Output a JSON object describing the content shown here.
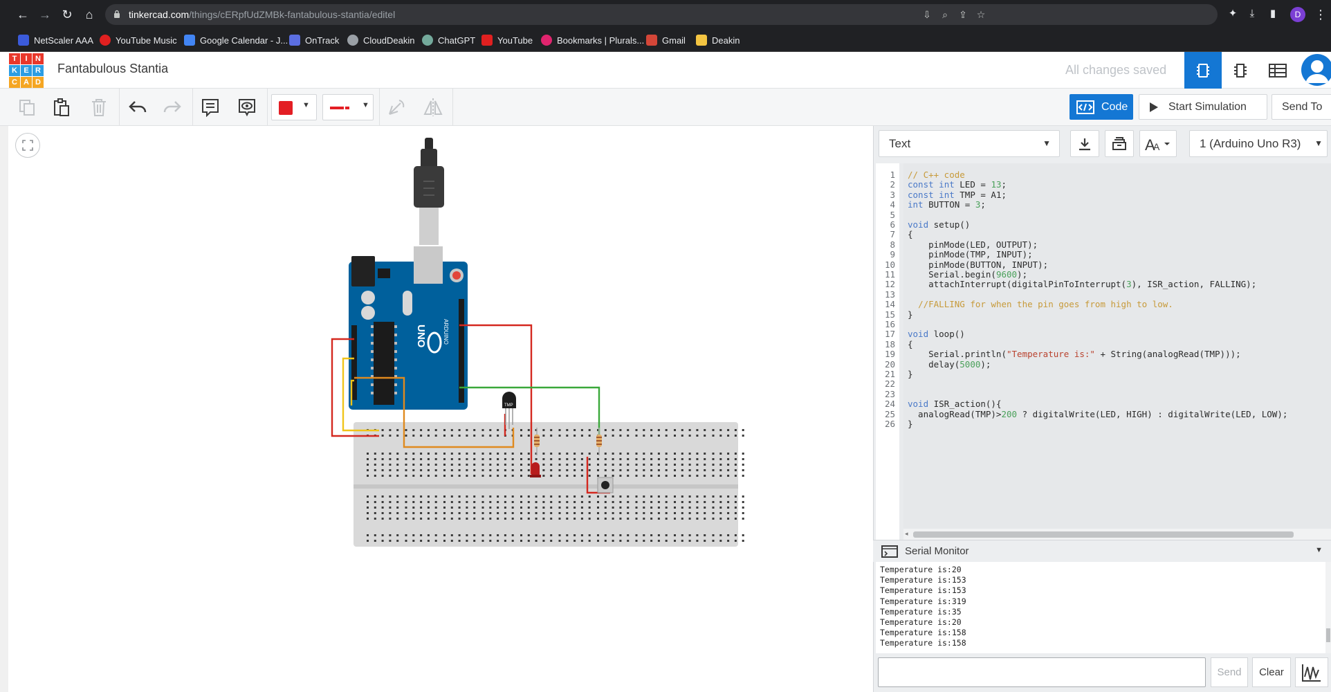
{
  "browser": {
    "url_host": "tinkercad.com",
    "url_path": "/things/cERpfUdZMBk-fantabulous-stantia/editel",
    "profile_initial": "D",
    "bookmarks": [
      {
        "label": "NetScaler AAA",
        "color": "#3b5bdb"
      },
      {
        "label": "YouTube Music",
        "color": "#e02020"
      },
      {
        "label": "Google Calendar - J...",
        "color": "#4285f4"
      },
      {
        "label": "OnTrack",
        "color": "#5b6ee1"
      },
      {
        "label": "CloudDeakin",
        "color": "#9aa0a6"
      },
      {
        "label": "ChatGPT",
        "color": "#74aa9c"
      },
      {
        "label": "YouTube",
        "color": "#e02020"
      },
      {
        "label": "Bookmarks | Plurals...",
        "color": "#e0246e"
      },
      {
        "label": "Gmail",
        "color": "#d44638"
      },
      {
        "label": "Deakin",
        "color": "#f4c542"
      }
    ]
  },
  "header": {
    "logo_letters": [
      "T",
      "I",
      "N",
      "K",
      "E",
      "R",
      "C",
      "A",
      "D"
    ],
    "logo_colors": [
      "#e9372b",
      "#e9372b",
      "#e9372b",
      "#2c9de3",
      "#2c9de3",
      "#2c9de3",
      "#f5a623",
      "#f5a623",
      "#f5a623"
    ],
    "title": "Fantabulous Stantia",
    "status": "All changes saved"
  },
  "toolbar": {
    "fill_color": "#e31e24",
    "line_color": "#e31e24",
    "code_label": "Code",
    "simulate_label": "Start Simulation",
    "send_to_label": "Send To"
  },
  "code_panel": {
    "mode": "Text",
    "device": "1 (Arduino Uno R3)",
    "lines": [
      "// C++ code",
      "const int LED = 13;",
      "const int TMP = A1;",
      "int BUTTON = 3;",
      "",
      "void setup()",
      "{",
      "    pinMode(LED, OUTPUT);",
      "    pinMode(TMP, INPUT);",
      "    pinMode(BUTTON, INPUT);",
      "    Serial.begin(9600);",
      "    attachInterrupt(digitalPinToInterrupt(3), ISR_action, FALLING);",
      "",
      "  //FALLING for when the pin goes from high to low.",
      "}",
      "",
      "void loop()",
      "{",
      "    Serial.println(\"Temperature is:\" + String(analogRead(TMP)));",
      "    delay(5000);",
      "}",
      "",
      "",
      "void ISR_action(){",
      "  analogRead(TMP)>200 ? digitalWrite(LED, HIGH) : digitalWrite(LED, LOW);",
      "}"
    ]
  },
  "serial_monitor": {
    "title": "Serial Monitor",
    "output": [
      "Temperature is:20",
      "Temperature is:153",
      "Temperature is:153",
      "Temperature is:319",
      "Temperature is:35",
      "Temperature is:20",
      "Temperature is:158",
      "Temperature is:158"
    ],
    "input_value": "",
    "send_label": "Send",
    "clear_label": "Clear"
  },
  "circuit": {
    "board": "UNO",
    "board_brand": "ARDUINO",
    "sensor_label": "TMP"
  }
}
